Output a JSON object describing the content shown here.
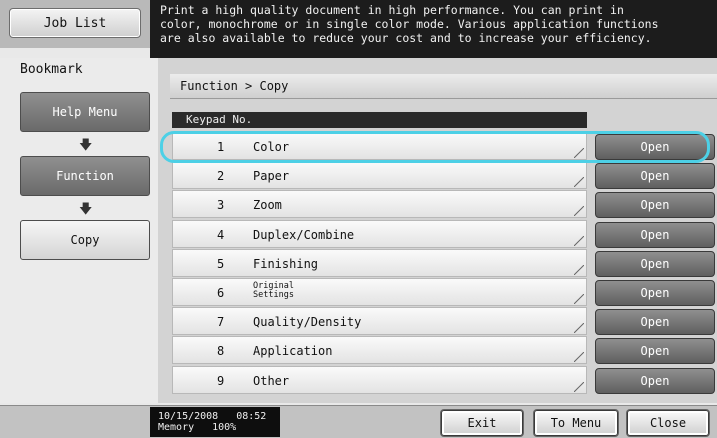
{
  "left": {
    "job_list_label": "Job List",
    "bookmark_label": "Bookmark",
    "nav": [
      {
        "label": "Help Menu"
      },
      {
        "label": "Function"
      },
      {
        "label": "Copy"
      }
    ]
  },
  "banner": {
    "text": "Print a high quality document in high performance. You can print in\ncolor, monochrome or in single color mode. Various application functions\nare also available to reduce your cost and to increase your efficiency."
  },
  "breadcrumb": "Function > Copy",
  "list": {
    "header": "Keypad No.",
    "open_label": "Open",
    "rows": [
      {
        "num": "1",
        "label": "Color"
      },
      {
        "num": "2",
        "label": "Paper"
      },
      {
        "num": "3",
        "label": "Zoom"
      },
      {
        "num": "4",
        "label": "Duplex/Combine"
      },
      {
        "num": "5",
        "label": "Finishing"
      },
      {
        "num": "6",
        "label": "Original Settings"
      },
      {
        "num": "7",
        "label": "Quality/Density"
      },
      {
        "num": "8",
        "label": "Application"
      },
      {
        "num": "9",
        "label": "Other"
      }
    ]
  },
  "status": {
    "date": "10/15/2008",
    "time": "08:52",
    "memory_label": "Memory",
    "memory_value": "100%"
  },
  "bottom": {
    "exit_label": "Exit",
    "to_menu_label": "To Menu",
    "close_label": "Close"
  },
  "colors": {
    "highlight": "#4dd0e6"
  }
}
